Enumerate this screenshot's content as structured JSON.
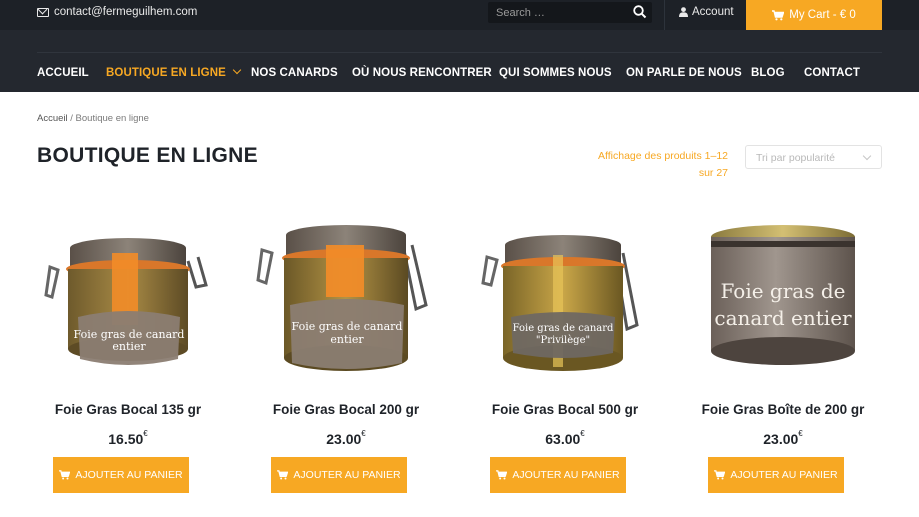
{
  "topbar": {
    "email": "contact@fermeguilhem.com",
    "search_placeholder": "Search …",
    "account_label": "Account",
    "cart_label": "My Cart - € 0"
  },
  "nav": {
    "items": [
      {
        "label": "ACCUEIL"
      },
      {
        "label": "BOUTIQUE EN LIGNE"
      },
      {
        "label": "NOS CANARDS"
      },
      {
        "label": "OÙ NOUS RENCONTRER"
      },
      {
        "label": "QUI SOMMES NOUS"
      },
      {
        "label": "ON PARLE DE NOUS"
      },
      {
        "label": "BLOG"
      },
      {
        "label": "CONTACT"
      }
    ]
  },
  "breadcrumb": {
    "home": "Accueil",
    "separator": "/",
    "current": "Boutique en ligne"
  },
  "page_title": "BOUTIQUE EN LIGNE",
  "result_count": {
    "line1": "Affichage des produits 1–12",
    "line2": "sur 27"
  },
  "orderby": {
    "selected": "Tri par popularité"
  },
  "products": [
    {
      "name": "Foie Gras Bocal 135 gr",
      "price": "16.50",
      "currency": "€",
      "button": "AJOUTER AU PANIER",
      "label_text_1": "Foie gras de canard",
      "label_text_2": "entier"
    },
    {
      "name": "Foie Gras Bocal 200 gr",
      "price": "23.00",
      "currency": "€",
      "button": "AJOUTER AU PANIER",
      "label_text_1": "Foie gras de canard",
      "label_text_2": "entier"
    },
    {
      "name": "Foie Gras Bocal 500 gr",
      "price": "63.00",
      "currency": "€",
      "button": "AJOUTER AU PANIER",
      "label_text_1": "Foie gras de canard",
      "label_text_2": "\"Privilège\""
    },
    {
      "name": "Foie Gras Boîte de 200 gr",
      "price": "23.00",
      "currency": "€",
      "button": "AJOUTER AU PANIER",
      "label_text_1": "Foie gras de",
      "label_text_2": "canard entier"
    }
  ],
  "colors": {
    "accent": "#f7a823",
    "topbar_bg": "#1d2127",
    "nav_bg": "#24282f",
    "text_dark": "#1f2329"
  }
}
